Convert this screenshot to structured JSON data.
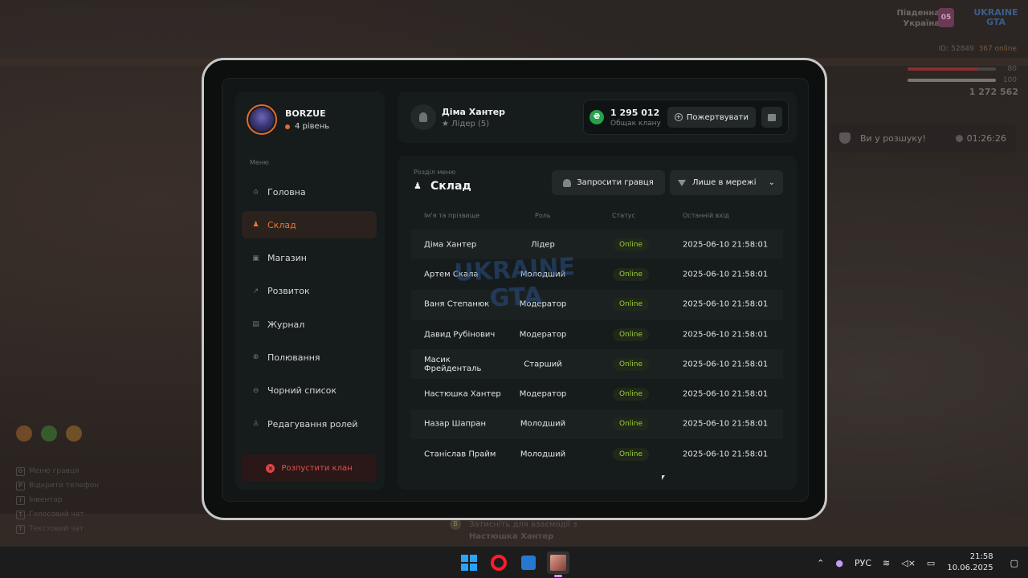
{
  "hud": {
    "region": "Південна\nУкраїна",
    "region_badge": "05",
    "logo": "UKRAINE\nGTA",
    "player_id": "ID: 52849",
    "online": "367 online",
    "health_value": "80",
    "armor_value": "100",
    "money": "1 272 562",
    "wanted_text": "Ви у розшуку!",
    "wanted_timer": "01:26:26",
    "interact_key": "B",
    "interact_line1": "Затисніть для взаємодії з",
    "interact_line2": "Настюшка Хантер",
    "hints": [
      {
        "key": "O",
        "label": "Меню гравця"
      },
      {
        "key": "P",
        "label": "Відкрити телефон"
      },
      {
        "key": "I",
        "label": "Інвентар"
      },
      {
        "key": "T",
        "label": "Голосовий чат"
      },
      {
        "key": "T",
        "label": "Текстовий чат"
      }
    ]
  },
  "profile": {
    "name": "BORZUE",
    "level": "4 рівень"
  },
  "menu": {
    "caption": "Меню",
    "items": [
      {
        "label": "Головна",
        "icon": "home-icon",
        "glyph": "⌂"
      },
      {
        "label": "Склад",
        "icon": "group-icon",
        "glyph": "♟",
        "active": true
      },
      {
        "label": "Магазин",
        "icon": "shop-icon",
        "glyph": "▣"
      },
      {
        "label": "Розвиток",
        "icon": "chart-icon",
        "glyph": "↗"
      },
      {
        "label": "Журнал",
        "icon": "book-icon",
        "glyph": "▤"
      },
      {
        "label": "Полювання",
        "icon": "crosshair-icon",
        "glyph": "⊕"
      },
      {
        "label": "Чорний список",
        "icon": "block-icon",
        "glyph": "⊖"
      },
      {
        "label": "Редагування ролей",
        "icon": "user-edit-icon",
        "glyph": "♙"
      }
    ],
    "dissolve_label": "Розпустити клан"
  },
  "leader": {
    "name": "Діма Хантер",
    "role": "★ Лідер (5)"
  },
  "bank": {
    "amount": "1 295 012",
    "label": "Общак клану",
    "donate_label": "Пожертвувати"
  },
  "section": {
    "caption": "Розділ меню",
    "title": "Склад",
    "invite_label": "Запросити гравця",
    "filter_label": "Лише в мережі"
  },
  "table": {
    "headers": [
      "Ім'я та прізвище",
      "Роль",
      "Статус",
      "Останній вхід"
    ],
    "rows": [
      {
        "name": "Діма Хантер",
        "role": "Лідер",
        "status": "Online",
        "last": "2025-06-10 21:58:01"
      },
      {
        "name": "Артем Скала",
        "role": "Молодший",
        "status": "Online",
        "last": "2025-06-10 21:58:01"
      },
      {
        "name": "Ваня Степанюк",
        "role": "Модератор",
        "status": "Online",
        "last": "2025-06-10 21:58:01"
      },
      {
        "name": "Давид Рубінович",
        "role": "Модератор",
        "status": "Online",
        "last": "2025-06-10 21:58:01"
      },
      {
        "name": "Масик Фрейденталь",
        "role": "Старший",
        "status": "Online",
        "last": "2025-06-10 21:58:01"
      },
      {
        "name": "Настюшка Хантер",
        "role": "Модератор",
        "status": "Online",
        "last": "2025-06-10 21:58:01"
      },
      {
        "name": "Назар Шапран",
        "role": "Молодший",
        "status": "Online",
        "last": "2025-06-10 21:58:01"
      },
      {
        "name": "Станіслав Прайм",
        "role": "Молодший",
        "status": "Online",
        "last": "2025-06-10 21:58:01"
      }
    ]
  },
  "watermark": "UKRAINE\nGTA",
  "taskbar": {
    "lang": "РУС",
    "time": "21:58",
    "date": "10.06.2025"
  },
  "colors": {
    "accent": "#e97836",
    "online": "#9ccf3b",
    "danger": "#e25151",
    "money": "#25a24d"
  }
}
